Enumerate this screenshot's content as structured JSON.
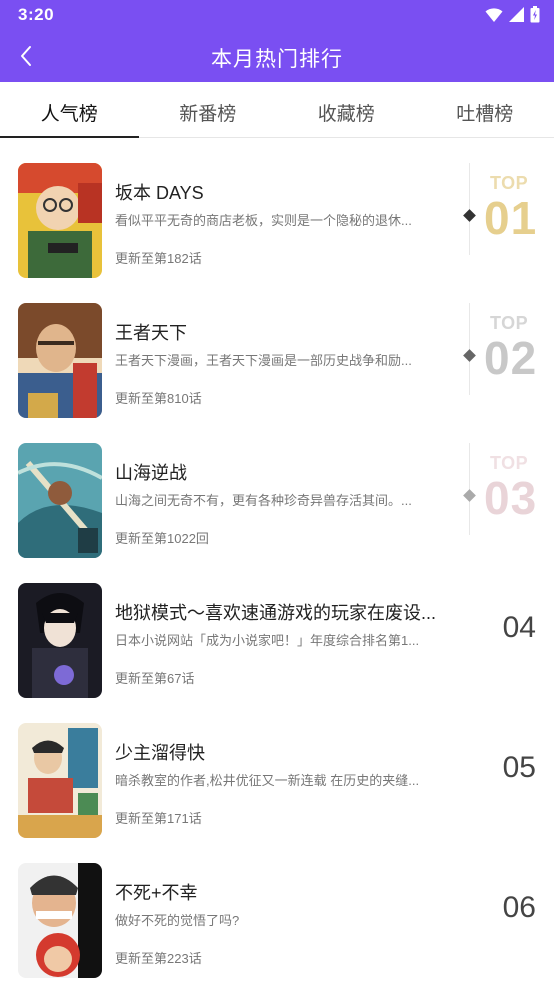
{
  "status": {
    "time": "3:20"
  },
  "header": {
    "title": "本月热门排行"
  },
  "tabs": [
    "人气榜",
    "新番榜",
    "收藏榜",
    "吐槽榜"
  ],
  "active_tab": 0,
  "colors": {
    "brand": "#7a4ff2",
    "top1": "#e9d7a6",
    "top2": "#cfcfcf",
    "top3": "#ecd8dc"
  },
  "items": [
    {
      "title": "坂本 DAYS",
      "desc": "看似平平无奇的商店老板，实则是一个隐秘的退休...",
      "update": "更新至第182话",
      "badge": "TOP",
      "rank": "01",
      "tier": "gold"
    },
    {
      "title": "王者天下",
      "desc": "王者天下漫画，王者天下漫画是一部历史战争和励...",
      "update": "更新至第810话",
      "badge": "TOP",
      "rank": "02",
      "tier": "silver"
    },
    {
      "title": "山海逆战",
      "desc": "山海之间无奇不有，更有各种珍奇异兽存活其间。...",
      "update": "更新至第1022回",
      "badge": "TOP",
      "rank": "03",
      "tier": "bronze"
    },
    {
      "title": "地狱模式～喜欢速通游戏的玩家在废设...",
      "desc": "日本小说网站「成为小说家吧！」年度综合排名第1...",
      "update": "更新至第67话",
      "badge": "",
      "rank": "04",
      "tier": "plain"
    },
    {
      "title": "少主溜得快",
      "desc": "暗杀教室的作者,松井优征又一新连载 在历史的夹缝...",
      "update": "更新至第171话",
      "badge": "",
      "rank": "05",
      "tier": "plain"
    },
    {
      "title": "不死+不幸",
      "desc": "做好不死的觉悟了吗?",
      "update": "更新至第223话",
      "badge": "",
      "rank": "06",
      "tier": "plain"
    }
  ]
}
